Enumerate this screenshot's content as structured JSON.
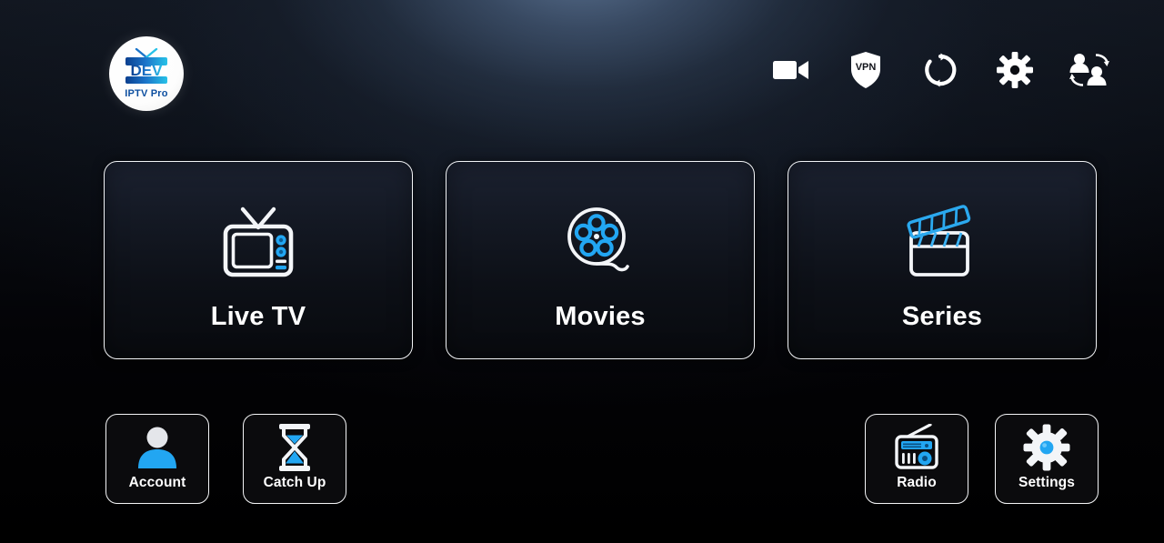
{
  "app": {
    "name": "DEV IPTV Pro",
    "logo": {
      "wordmark": "DEV",
      "subtitle": "IPTV Pro",
      "icon_name": "tv-logo-icon"
    },
    "colors": {
      "accent_blue": "#22a6f2",
      "accent_blue_deep": "#0d7fd0",
      "border_white": "#f2f4f7",
      "text_white": "#ffffff",
      "background_black": "#000000",
      "background_glow": "#3e4c60",
      "card_fill": "#141924"
    }
  },
  "header": {
    "icons": [
      {
        "name": "video-camera-icon",
        "label": "Recording"
      },
      {
        "name": "vpn-shield-icon",
        "label": "VPN"
      },
      {
        "name": "refresh-sync-icon",
        "label": "Refresh"
      },
      {
        "name": "gear-icon",
        "label": "Settings"
      },
      {
        "name": "switch-user-icon",
        "label": "Switch User"
      }
    ],
    "vpn_badge_text": "VPN"
  },
  "main": {
    "cards": [
      {
        "label": "Live TV",
        "icon_name": "tv-icon"
      },
      {
        "label": "Movies",
        "icon_name": "film-reel-icon"
      },
      {
        "label": "Series",
        "icon_name": "clapperboard-icon"
      }
    ]
  },
  "bottom": {
    "left_buttons": [
      {
        "label": "Account",
        "icon_name": "user-avatar-icon"
      },
      {
        "label": "Catch Up",
        "icon_name": "hourglass-icon"
      }
    ],
    "right_buttons": [
      {
        "label": "Radio",
        "icon_name": "radio-icon"
      },
      {
        "label": "Settings",
        "icon_name": "gear-icon"
      }
    ]
  }
}
